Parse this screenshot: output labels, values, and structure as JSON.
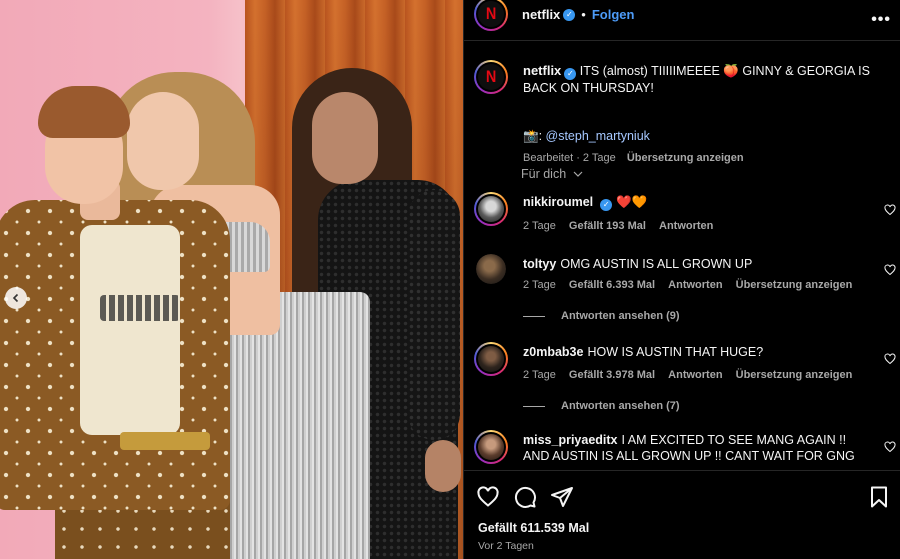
{
  "post": {
    "account": "netflix",
    "follow_label": "Folgen",
    "separator": "•",
    "more_label": "•••",
    "caption_text": "ITS (almost) TIIIIIMEEEE 🍑 GINNY & GEORGIA IS BACK ON THURSDAY!",
    "credit_prefix": "📸: ",
    "credit_mention": "@steph_martyniuk",
    "edited_label": "Bearbeitet · 2 Tage",
    "translation_label": "Übersetzung anzeigen",
    "filter_label": "Für dich",
    "likes_label": "Gefällt 611.539 Mal",
    "time_label": "Vor 2 Tagen"
  },
  "comments": [
    {
      "username": "nikkiroumel",
      "verified": true,
      "text": "❤️🧡",
      "time": "2 Tage",
      "likes": "Gefällt 193 Mal",
      "reply": "Antworten",
      "translate": "",
      "view_replies": ""
    },
    {
      "username": "toltyy",
      "verified": false,
      "text": "OMG AUSTIN IS ALL GROWN UP",
      "time": "2 Tage",
      "likes": "Gefällt 6.393 Mal",
      "reply": "Antworten",
      "translate": "Übersetzung anzeigen",
      "view_replies": "Antworten ansehen (9)"
    },
    {
      "username": "z0mbab3e",
      "verified": false,
      "text": "HOW IS AUSTIN THAT HUGE?",
      "time": "2 Tage",
      "likes": "Gefällt 3.978 Mal",
      "reply": "Antworten",
      "translate": "Übersetzung anzeigen",
      "view_replies": "Antworten ansehen (7)"
    },
    {
      "username": "miss_priyaeditx",
      "verified": false,
      "text": "I AM EXCITED TO SEE MANG AGAIN !! AND AUSTIN IS ALL GROWN UP !! CANT WAIT FOR GNG",
      "time": "",
      "likes": "",
      "reply": "",
      "translate": "",
      "view_replies": ""
    }
  ],
  "brand_colors": {
    "netflix_red": "#e50914",
    "link_blue": "#4d9bf7",
    "verified_blue": "#3897f0"
  },
  "icons": [
    "netflix-logo-icon",
    "verified-icon",
    "more-icon",
    "chevron-down-icon",
    "heart-icon",
    "comment-icon",
    "share-icon",
    "bookmark-icon",
    "carousel-prev-icon"
  ]
}
